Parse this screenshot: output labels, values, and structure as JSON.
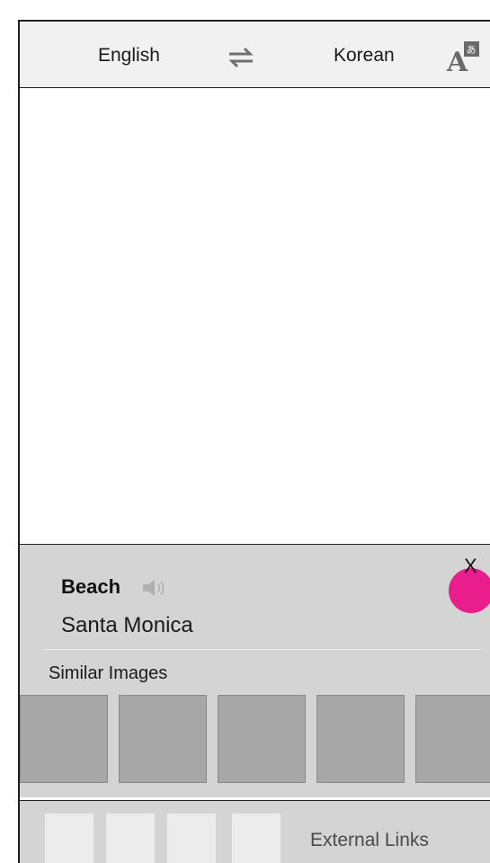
{
  "header": {
    "source_language": "English",
    "target_language": "Korean",
    "swap_icon": "swap-arrows-icon",
    "translate_icon": "translate-icon"
  },
  "result": {
    "word": "Beach",
    "speaker_icon": "speaker-icon",
    "subtitle": "Santa Monica",
    "close_label": "X",
    "close_color": "#e91e8c"
  },
  "similar": {
    "label": "Similar Images",
    "thumbnail_count": 5
  },
  "footer": {
    "external_links_label": "External Links",
    "tile_count": 4
  },
  "colors": {
    "accent": "#e91e8c",
    "panel": "#d4d4d4",
    "thumbnail": "#a7a7a7"
  }
}
